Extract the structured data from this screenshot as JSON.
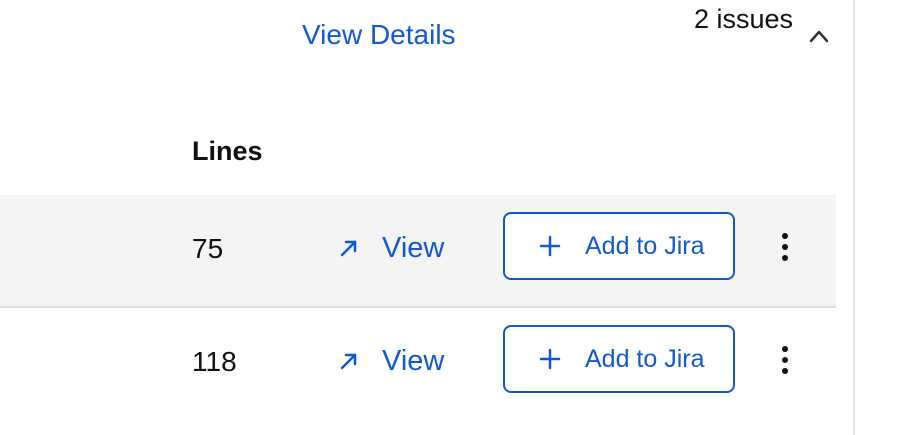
{
  "header": {
    "view_details_label": "View Details",
    "issues_count": "2 issues",
    "collapse_icon": "chevron-up-icon"
  },
  "table": {
    "columns": [
      "Lines"
    ],
    "rows": [
      {
        "lines": "75",
        "view_label": "View",
        "view_icon": "arrow-up-right-icon",
        "jira_label": "Add to Jira",
        "jira_icon": "plus-icon",
        "menu_icon": "kebab-menu-icon"
      },
      {
        "lines": "118",
        "view_label": "View",
        "view_icon": "arrow-up-right-icon",
        "jira_label": "Add to Jira",
        "jira_icon": "plus-icon",
        "menu_icon": "kebab-menu-icon"
      }
    ]
  },
  "colors": {
    "accent": "#1157d6",
    "row_alt_background": "#f4f4f4",
    "text": "#111111"
  }
}
